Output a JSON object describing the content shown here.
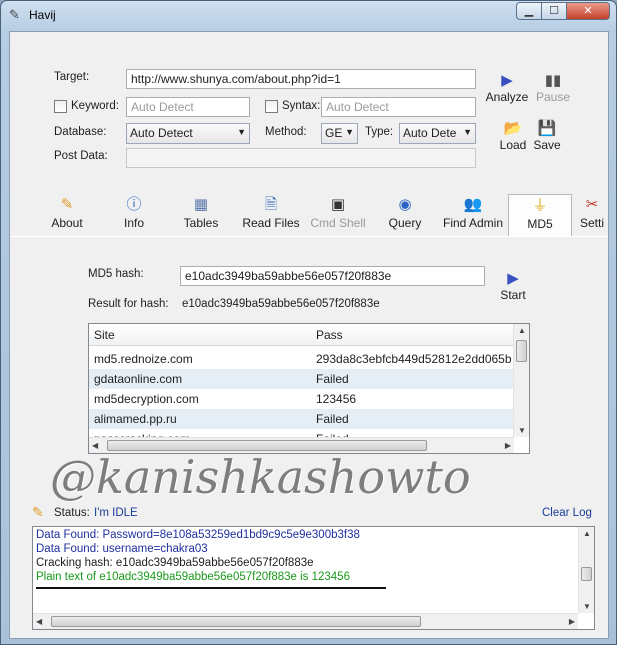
{
  "window": {
    "title": "Havij",
    "controls": {
      "minimize": "▁",
      "maximize": "☐",
      "close": "✕"
    }
  },
  "form": {
    "target_label": "Target:",
    "target_value": "http://www.shunya.com/about.php?id=1",
    "keyword_label": "Keyword:",
    "keyword_placeholder": "Auto Detect",
    "syntax_label": "Syntax:",
    "syntax_placeholder": "Auto Detect",
    "database_label": "Database:",
    "database_value": "Auto Detect",
    "method_label": "Method:",
    "method_value": "GE",
    "type_label": "Type:",
    "type_value": "Auto Dete",
    "postdata_label": "Post Data:",
    "postdata_value": ""
  },
  "actions": {
    "analyze": "Analyze",
    "pause": "Pause",
    "load": "Load",
    "save": "Save"
  },
  "tabs": [
    {
      "label": "About",
      "icon": "pencil-icon"
    },
    {
      "label": "Info",
      "icon": "info-icon"
    },
    {
      "label": "Tables",
      "icon": "table-icon"
    },
    {
      "label": "Read Files",
      "icon": "file-icon"
    },
    {
      "label": "Cmd Shell",
      "icon": "terminal-icon"
    },
    {
      "label": "Query",
      "icon": "query-icon"
    },
    {
      "label": "Find Admin",
      "icon": "users-icon"
    },
    {
      "label": "MD5",
      "icon": "funnel-icon"
    },
    {
      "label": "Setti",
      "icon": "tools-icon"
    }
  ],
  "md5": {
    "hash_label": "MD5 hash:",
    "hash_value": "e10adc3949ba59abbe56e057f20f883e",
    "result_label": "Result for hash:",
    "result_value": "e10adc3949ba59abbe56e057f20f883e",
    "start": "Start",
    "columns": [
      "Site",
      "Pass"
    ],
    "rows": [
      {
        "site": "md5.rednoize.com",
        "pass": "293da8c3ebfcb449d52812e2dd065b"
      },
      {
        "site": "gdataonline.com",
        "pass": "Failed"
      },
      {
        "site": "md5decryption.com",
        "pass": "123456"
      },
      {
        "site": "alimamed.pp.ru",
        "pass": "Failed"
      },
      {
        "site": "passcracking.com",
        "pass": "Failed"
      }
    ]
  },
  "watermark": "@kanishkashowto",
  "status": {
    "label": "Status:",
    "value": "I'm IDLE",
    "clear_log": "Clear Log"
  },
  "log": [
    {
      "text": "Data Found: Password=8e108a53259ed1bd9c9c5e9e300b3f38",
      "color": "#1f2f9e"
    },
    {
      "text": "Data Found: username=chakra03",
      "color": "#1f2f9e"
    },
    {
      "text": "Cracking hash: e10adc3949ba59abbe56e057f20f883e",
      "color": "#1e1e1e"
    },
    {
      "text": "Plain text of e10adc3949ba59abbe56e057f20f883e is 123456",
      "color": "#1a9a1a"
    }
  ]
}
